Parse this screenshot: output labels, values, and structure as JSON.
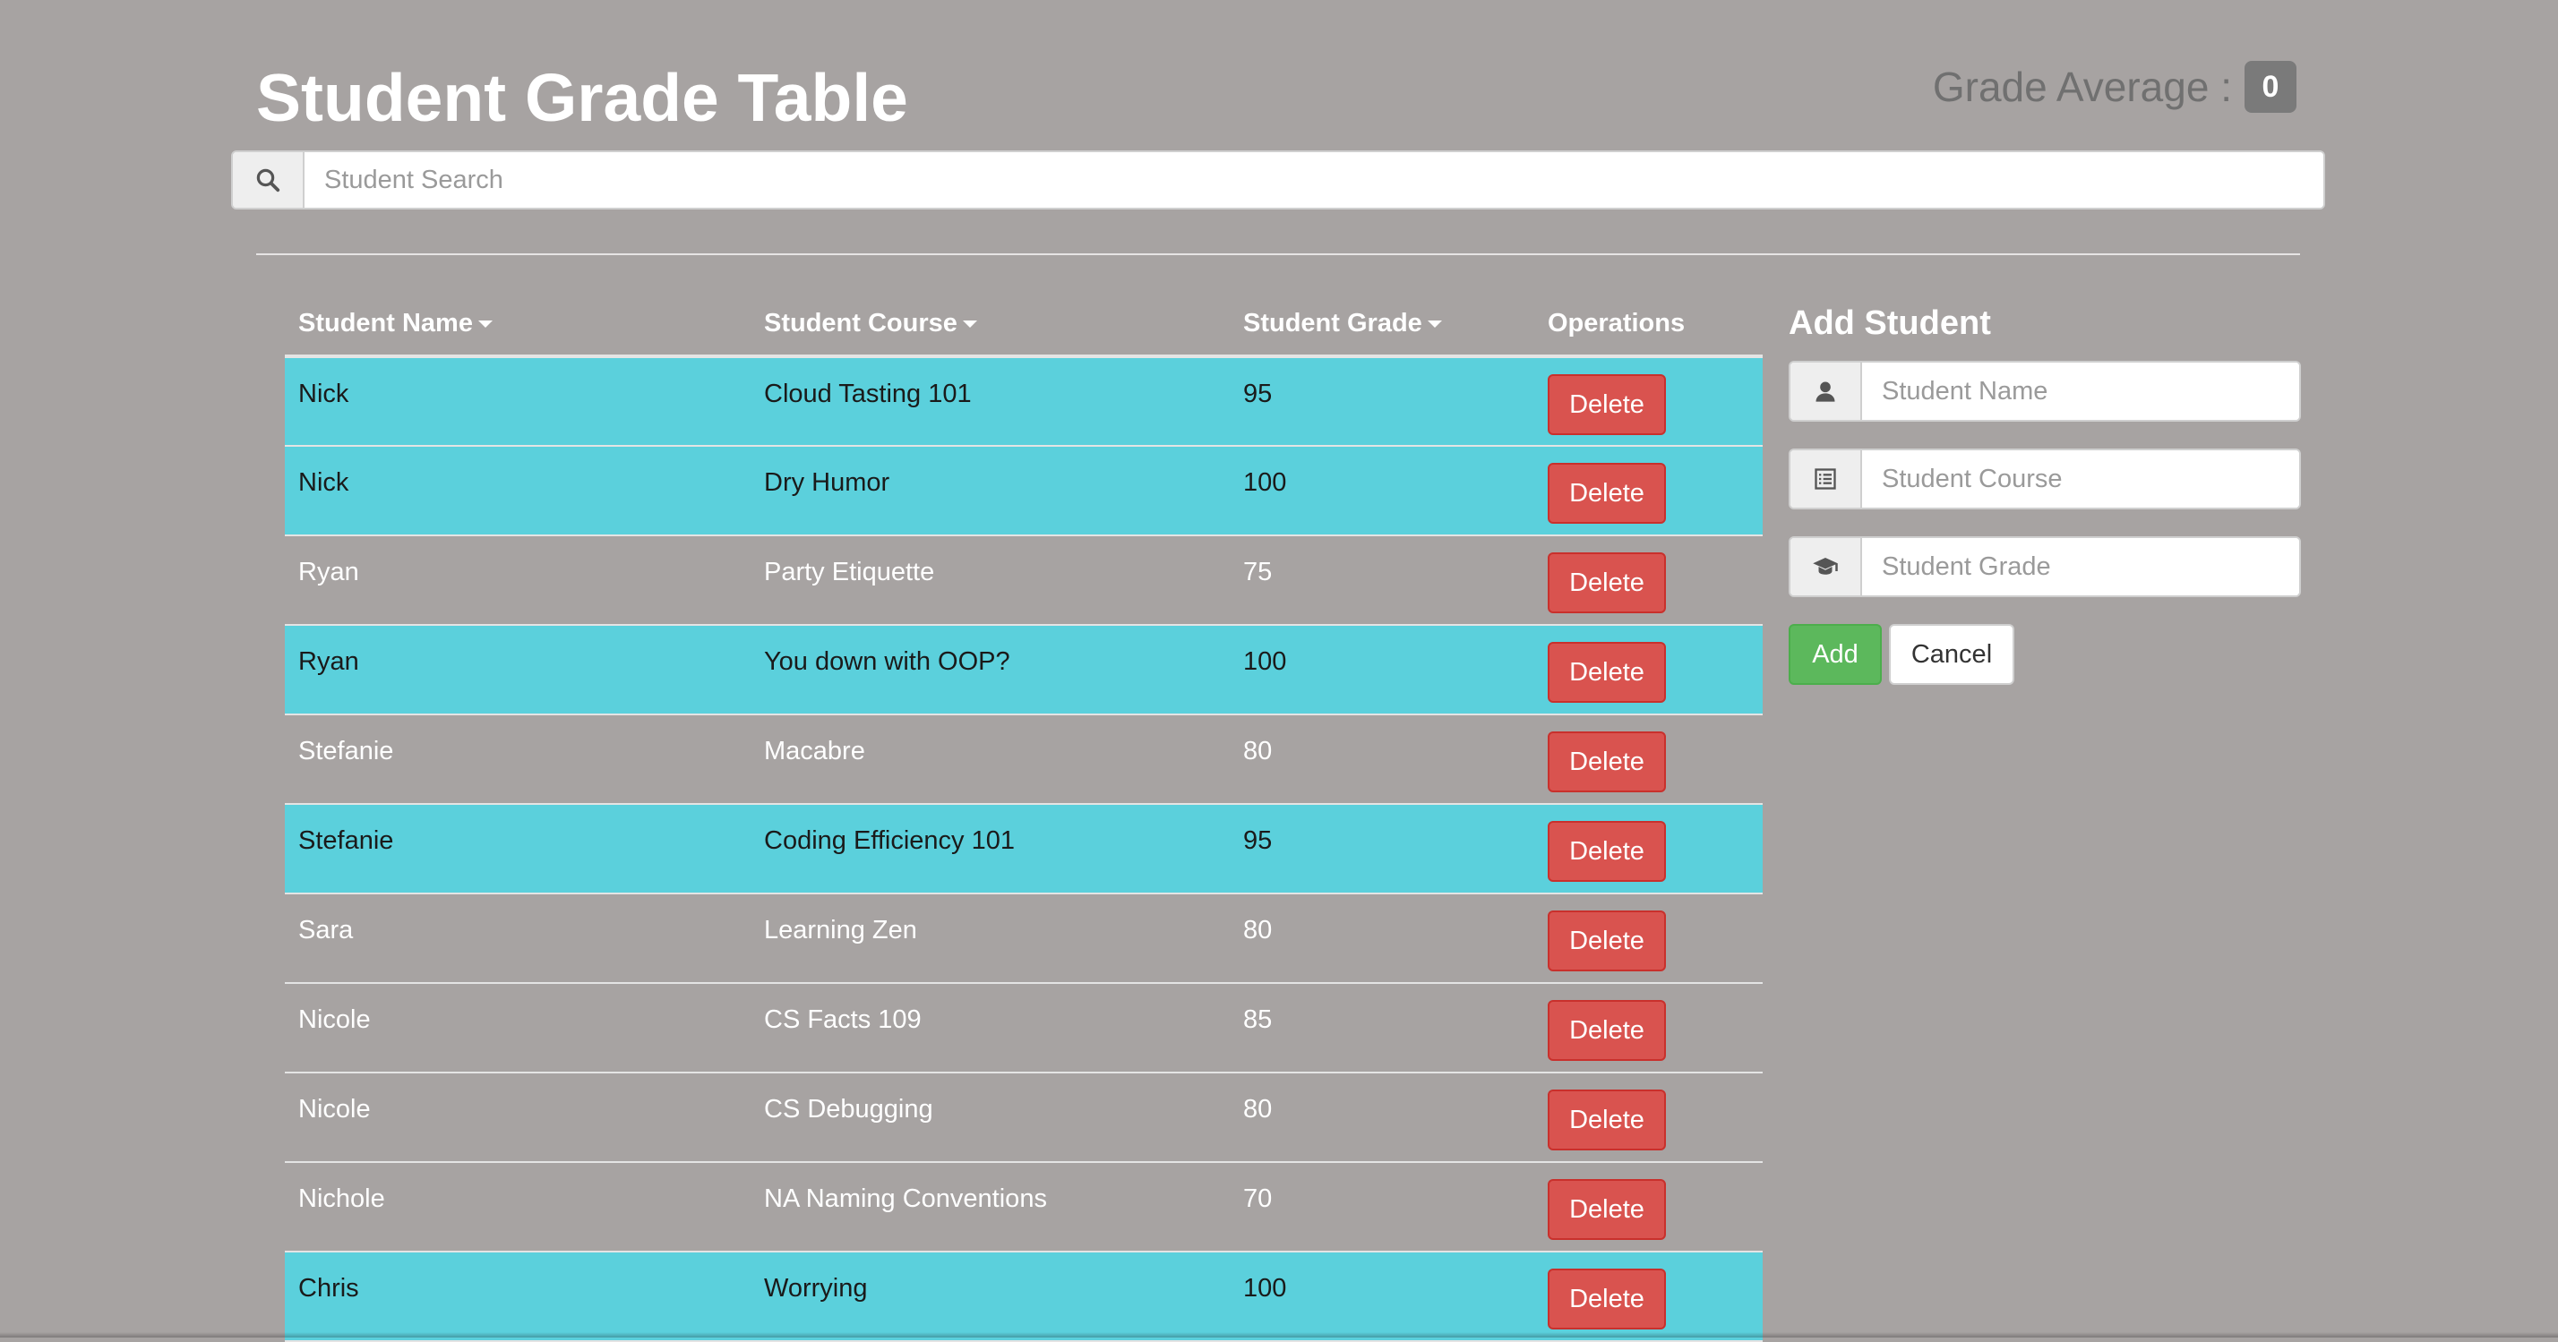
{
  "header": {
    "title": "Student Grade Table",
    "grade_average_label": "Grade Average :",
    "grade_average_value": "0"
  },
  "search": {
    "placeholder": "Student Search",
    "icon": "search-icon"
  },
  "table": {
    "columns": [
      "Student Name",
      "Student Course",
      "Student Grade",
      "Operations"
    ],
    "delete_label": "Delete",
    "rows": [
      {
        "name": "Nick",
        "course": "Cloud Tasting 101",
        "grade": "95",
        "highlighted": true
      },
      {
        "name": "Nick",
        "course": "Dry Humor",
        "grade": "100",
        "highlighted": true
      },
      {
        "name": "Ryan",
        "course": "Party Etiquette",
        "grade": "75",
        "highlighted": false
      },
      {
        "name": "Ryan",
        "course": "You down with OOP?",
        "grade": "100",
        "highlighted": true
      },
      {
        "name": "Stefanie",
        "course": "Macabre",
        "grade": "80",
        "highlighted": false
      },
      {
        "name": "Stefanie",
        "course": "Coding Efficiency 101",
        "grade": "95",
        "highlighted": true
      },
      {
        "name": "Sara",
        "course": "Learning Zen",
        "grade": "80",
        "highlighted": false
      },
      {
        "name": "Nicole",
        "course": "CS Facts 109",
        "grade": "85",
        "highlighted": false
      },
      {
        "name": "Nicole",
        "course": "CS Debugging",
        "grade": "80",
        "highlighted": false
      },
      {
        "name": "Nichole",
        "course": "NA Naming Conventions",
        "grade": "70",
        "highlighted": false
      },
      {
        "name": "Chris",
        "course": "Worrying",
        "grade": "100",
        "highlighted": true
      }
    ]
  },
  "add_student": {
    "title": "Add Student",
    "name_placeholder": "Student Name",
    "course_placeholder": "Student Course",
    "grade_placeholder": "Student Grade",
    "add_label": "Add",
    "cancel_label": "Cancel"
  },
  "colors": {
    "background": "#a7a3a2",
    "row_highlight": "#5bd0dc",
    "delete": "#d9534f",
    "add": "#5cb85c"
  }
}
